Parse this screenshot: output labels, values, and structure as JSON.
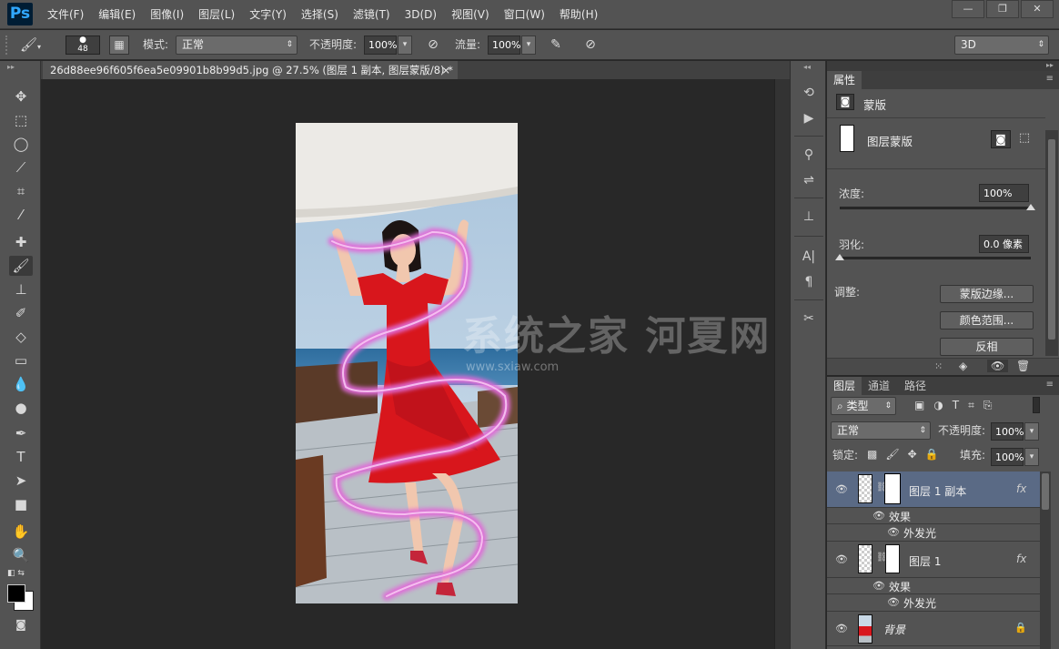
{
  "app": {
    "logo": "Ps"
  },
  "menu": [
    "文件(F)",
    "编辑(E)",
    "图像(I)",
    "图层(L)",
    "文字(Y)",
    "选择(S)",
    "滤镜(T)",
    "3D(D)",
    "视图(V)",
    "窗口(W)",
    "帮助(H)"
  ],
  "window_controls": {
    "minimize": "—",
    "restore": "❐",
    "close": "✕"
  },
  "options": {
    "brush_size": "48",
    "mode_label": "模式:",
    "mode_value": "正常",
    "opacity_label": "不透明度:",
    "opacity_value": "100%",
    "flow_label": "流量:",
    "flow_value": "100%",
    "workspace": "3D"
  },
  "document": {
    "tab_title": "26d88ee96f605f6ea5e09901b8b99d5.jpg @ 27.5% (图层 1 副本, 图层蒙版/8) *",
    "close": "×"
  },
  "watermark": {
    "brand": "系统之家 河夏网",
    "url": "www.sxiaw.com"
  },
  "properties": {
    "tab": "属性",
    "mask_title": "蒙版",
    "layer_mask_label": "图层蒙版",
    "density_label": "浓度:",
    "density_value": "100%",
    "density_level": 1.0,
    "feather_label": "羽化:",
    "feather_value": "0.0 像素",
    "feather_level": 0.0,
    "adjust_label": "调整:",
    "buttons": [
      "蒙版边缘...",
      "颜色范围...",
      "反相"
    ]
  },
  "layers_panel": {
    "tabs": [
      "图层",
      "通道",
      "路径"
    ],
    "filter_kind": "类型",
    "blend_mode": "正常",
    "opacity_label": "不透明度:",
    "opacity_value": "100%",
    "lock_label": "锁定:",
    "fill_label": "填充:",
    "fill_value": "100%",
    "layers": [
      {
        "name": "图层 1 副本",
        "fx": "fx",
        "effects_label": "效果",
        "effect": "外发光",
        "selected": true
      },
      {
        "name": "图层 1",
        "fx": "fx",
        "effects_label": "效果",
        "effect": "外发光",
        "selected": false
      },
      {
        "name": "背景",
        "locked": true
      }
    ]
  },
  "colors": {
    "accent": "#31a8ff",
    "selected_layer": "#5a6a85",
    "dress_red": "#d8161c",
    "ribbon": "#e06ad8"
  }
}
